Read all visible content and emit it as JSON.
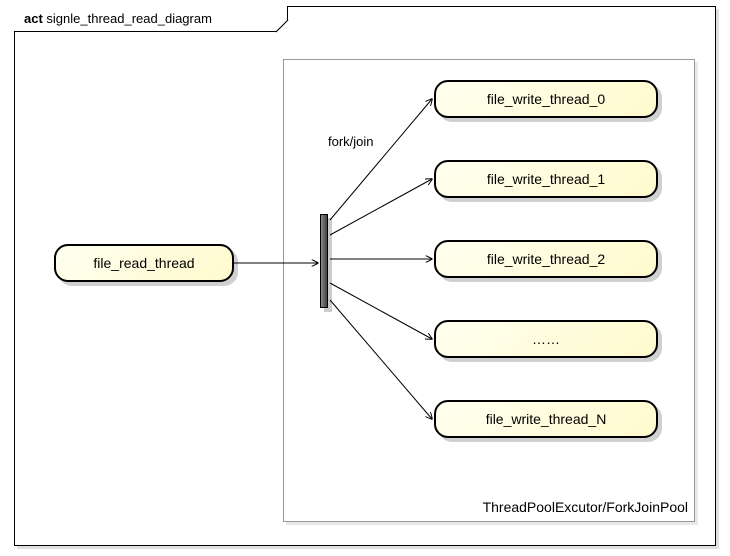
{
  "frame": {
    "prefix": "act",
    "title": "signle_thread_read_diagram"
  },
  "pool": {
    "label": "ThreadPoolExcutor/ForkJoinPool"
  },
  "nodes": {
    "read": "file_read_thread",
    "w0": "file_write_thread_0",
    "w1": "file_write_thread_1",
    "w2": "file_write_thread_2",
    "dots": "……",
    "wN": "file_write_thread_N"
  },
  "edgeLabel": "fork/join",
  "chart_data": {
    "type": "diagram",
    "diagram_kind": "uml-activity",
    "title": "signle_thread_read_diagram",
    "containers": [
      {
        "id": "pool",
        "label": "ThreadPoolExcutor/ForkJoinPool",
        "contains": [
          "fork",
          "w0",
          "w1",
          "w2",
          "dots",
          "wN"
        ]
      }
    ],
    "nodes": [
      {
        "id": "read",
        "label": "file_read_thread",
        "type": "activity"
      },
      {
        "id": "fork",
        "label": "",
        "type": "fork-join-bar"
      },
      {
        "id": "w0",
        "label": "file_write_thread_0",
        "type": "activity"
      },
      {
        "id": "w1",
        "label": "file_write_thread_1",
        "type": "activity"
      },
      {
        "id": "w2",
        "label": "file_write_thread_2",
        "type": "activity"
      },
      {
        "id": "dots",
        "label": "……",
        "type": "activity"
      },
      {
        "id": "wN",
        "label": "file_write_thread_N",
        "type": "activity"
      }
    ],
    "edges": [
      {
        "from": "read",
        "to": "fork",
        "label": ""
      },
      {
        "from": "fork",
        "to": "w0",
        "label": "fork/join"
      },
      {
        "from": "fork",
        "to": "w1",
        "label": ""
      },
      {
        "from": "fork",
        "to": "w2",
        "label": ""
      },
      {
        "from": "fork",
        "to": "dots",
        "label": ""
      },
      {
        "from": "fork",
        "to": "wN",
        "label": ""
      }
    ]
  }
}
